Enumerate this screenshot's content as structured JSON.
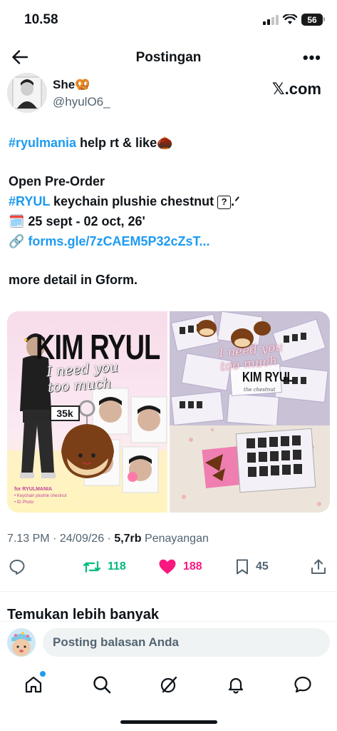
{
  "status_bar": {
    "time": "10.58",
    "battery": "56"
  },
  "nav": {
    "title": "Postingan"
  },
  "author": {
    "name": "She🥨",
    "handle": "@hyulO6_",
    "source": "𝕏.com"
  },
  "tweet": {
    "hashtag_1": "#ryulmania",
    "line_1_rest": " help rt & like🌰",
    "line_2": "Open Pre-Order",
    "hashtag_2": "#RYUL",
    "line_3_rest": " keychain plushie chestnut ",
    "line_3_keycap": "?",
    "line_3_tail": ".ᐟ",
    "date_emoji": "🗓️",
    "line_4": " 25 sept - 02 oct, 26'",
    "link_emoji": "🔗",
    "link": "forms.gle/7zCAEM5P32cZsT...",
    "line_6": "more detail in Gform."
  },
  "media": {
    "left": {
      "title": "KIM RYUL",
      "script_text": "I need you too much",
      "price": "35k",
      "caption_head": "for RYULMANIA",
      "caption_items": [
        "• Keychain plushie chestnut",
        "• ID Photo"
      ]
    },
    "right": {
      "title": "KIM RYUL",
      "subtitle": "the chestnut",
      "script_text": "I need you too much"
    }
  },
  "meta": {
    "time": "7.13 PM",
    "date": "24/09/26",
    "views": "5,7rb",
    "views_label": "Penayangan"
  },
  "actions": {
    "retweets": "118",
    "likes": "188",
    "bookmarks": "45"
  },
  "discover": {
    "title": "Temukan lebih banyak"
  },
  "reply": {
    "placeholder": "Posting balasan Anda"
  },
  "colors": {
    "accent": "#1d9bf0",
    "retweet": "#00ba7c",
    "like": "#f91880",
    "text": "#0f1419",
    "muted": "#536471"
  }
}
